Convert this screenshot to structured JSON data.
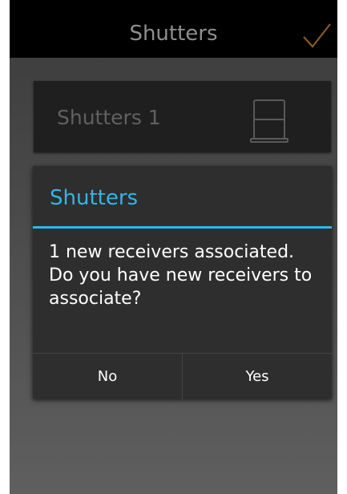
{
  "header": {
    "title": "Shutters",
    "confirm_icon": "checkmark-icon"
  },
  "tile": {
    "label": "Shutters 1",
    "icon": "shutter-icon"
  },
  "dialog": {
    "title": "Shutters",
    "message": "1 new receivers associated.\n Do you have new receivers to associate?",
    "no_label": "No",
    "yes_label": "Yes"
  },
  "colors": {
    "accent": "#33b5e5",
    "topbar": "#000000",
    "dialog_bg": "#2e2e2e",
    "tile_bg": "#1f1f1f"
  }
}
